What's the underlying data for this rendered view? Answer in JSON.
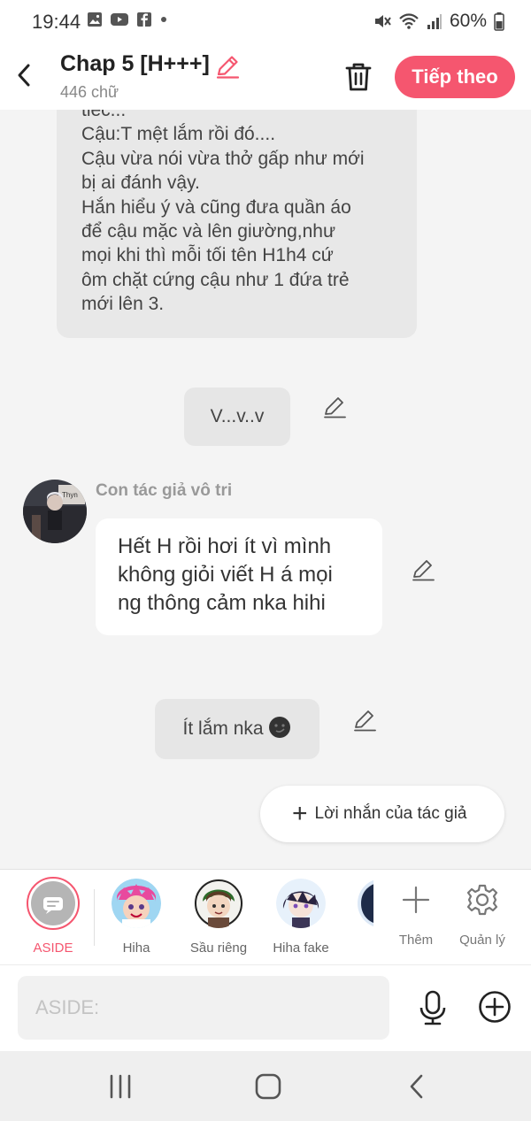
{
  "status_bar": {
    "time": "19:44",
    "battery": "60%",
    "notification_icons": [
      "gallery-icon",
      "youtube-icon",
      "facebook-icon",
      "dot-icon"
    ]
  },
  "header": {
    "title": "Chap 5 [H+++]",
    "word_count": "446 chữ",
    "next_label": "Tiếp theo",
    "accent_color": "#f5566f"
  },
  "narration": {
    "lines": [
      "tiec...",
      "Cậu:T mệt lắm rồi đó....",
      "Cậu vừa nói vừa thở gấp như mới",
      "bị ai đánh vậy.",
      "Hắn hiểu ý và cũng đưa quần áo",
      "để cậu mặc và lên giường,như",
      "mọi khi thì mỗi tối tên H1h4 cứ",
      "ôm chặt cứng cậu như 1 đứa trẻ",
      "mới lên 3."
    ]
  },
  "messages": {
    "aside_1": "V...v..v",
    "author_name": "Con tác giả vô tri",
    "author_lines": [
      "Hết H rồi hơi ít vì mình",
      "không giỏi viết H á mọi",
      "ng thông cảm nka hihi"
    ],
    "aside_2": "Ít lắm nka",
    "author_note_label": "Lời nhắn của tác giả"
  },
  "characters": [
    {
      "name": "ASIDE",
      "selected": true
    },
    {
      "name": "Hiha"
    },
    {
      "name": "Sầu riêng"
    },
    {
      "name": "Hiha fake"
    }
  ],
  "tools": {
    "add_label": "Thêm",
    "manage_label": "Quản lý"
  },
  "composer": {
    "placeholder": "ASIDE:"
  }
}
